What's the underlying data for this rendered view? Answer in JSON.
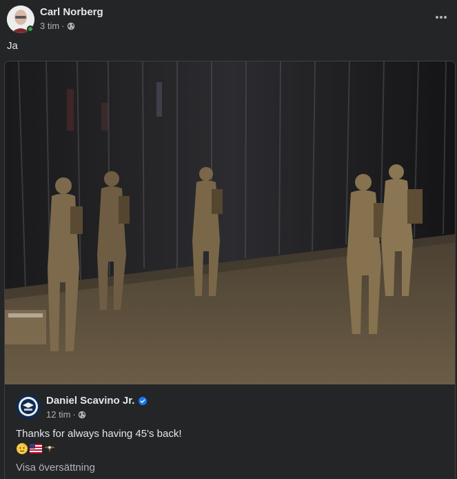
{
  "post": {
    "author": "Carl Norberg",
    "time": "3 tim",
    "separator": "·",
    "privacy_icon": "globe-icon",
    "online": true,
    "text": "Ja",
    "more_icon": "more-horizontal-icon"
  },
  "shared": {
    "author": "Daniel Scavino Jr.",
    "verified": true,
    "time": "12 tim",
    "separator": "·",
    "privacy_icon": "globe-icon",
    "text": "Thanks for always having 45's back!",
    "emojis": [
      "saluting-face-emoji",
      "us-flag-emoji",
      "eagle-emoji"
    ],
    "translate_label": "Visa översättning"
  },
  "colors": {
    "background": "#242526",
    "primary_text": "#e4e6eb",
    "secondary_text": "#b0b3b8",
    "online_green": "#31a24c",
    "verified_blue": "#1877f2"
  }
}
